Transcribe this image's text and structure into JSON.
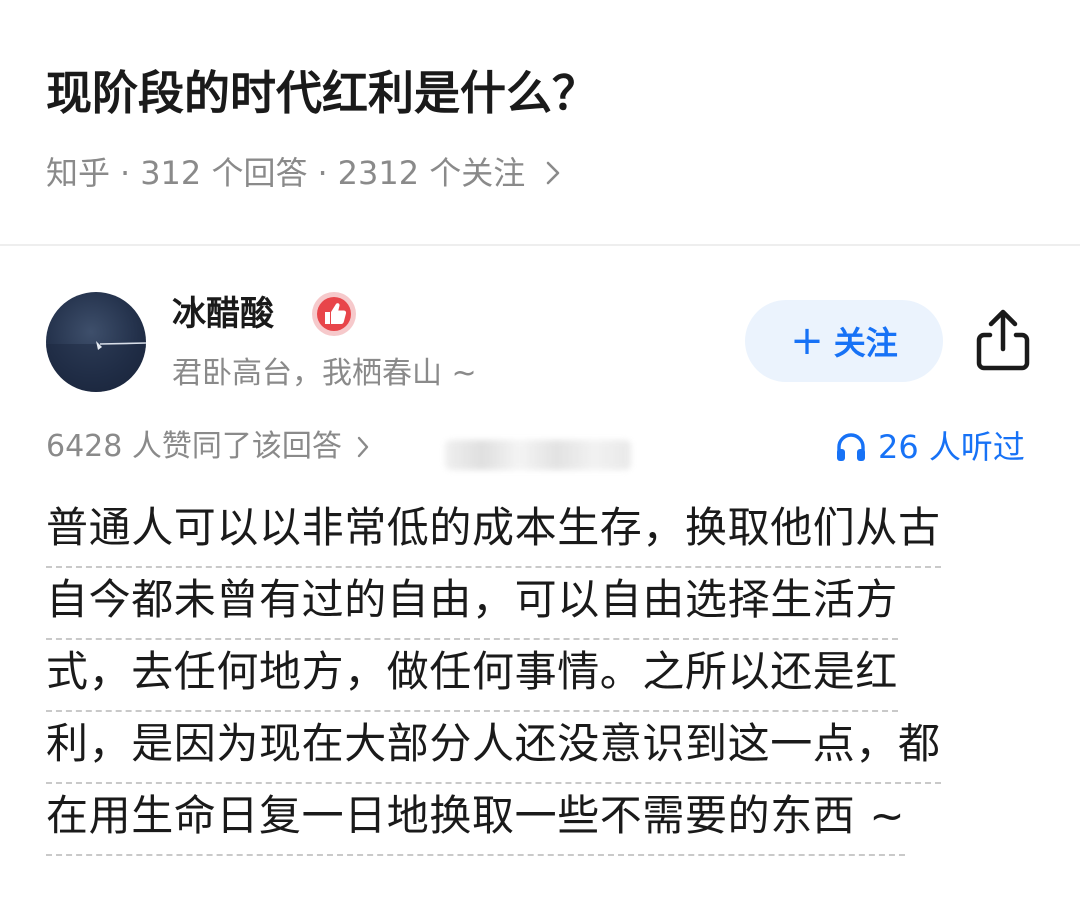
{
  "question": {
    "title": "现阶段的时代红利是什么？",
    "source": "知乎",
    "separator": "·",
    "answers_count": "312 个回答",
    "followers_count": "2312 个关注"
  },
  "author": {
    "name": "冰醋酸",
    "bio": "君卧高台，我栖春山 ~",
    "badge_icon": "thumbs-up-badge-icon",
    "follow_label": "关注",
    "follow_plus": "+"
  },
  "stats": {
    "upvotes": "6428 人赞同了该回答",
    "listeners": "26 人听过"
  },
  "answer": {
    "lines": [
      "普通人可以以非常低的成本生存，换取他们从古",
      "自今都未曾有过的自由，可以自由选择生活方",
      "式，去任何地方，做任何事情。之所以还是红",
      "利，是因为现在大部分人还没意识到这一点，都",
      "在用生命日复一日地换取一些不需要的东西 ~"
    ]
  },
  "colors": {
    "accent": "#1772f6",
    "follow_bg": "#ebf3fd",
    "muted_text": "#8a8a8a",
    "badge_red": "#e8454a"
  }
}
